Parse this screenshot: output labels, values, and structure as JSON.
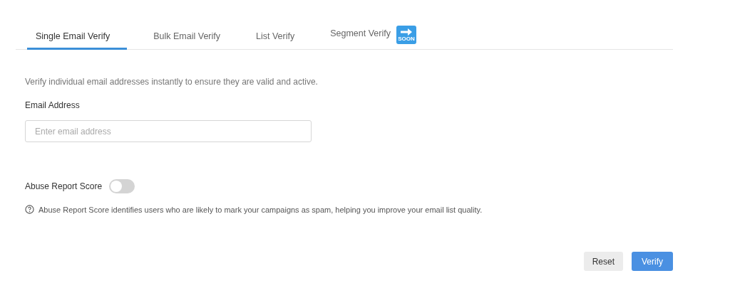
{
  "tabs": [
    {
      "label": "Single Email Verify",
      "selected": true
    },
    {
      "label": "Bulk Email Verify",
      "selected": false
    },
    {
      "label": "List Verify",
      "selected": false
    },
    {
      "label": "Segment Verify",
      "selected": false,
      "badge": "SOON"
    }
  ],
  "description": "Verify individual email addresses instantly to ensure they are valid and active.",
  "email_field": {
    "label": "Email Address",
    "placeholder": "Enter email address"
  },
  "abuse_toggle": {
    "label": "Abuse Report Score",
    "on": false
  },
  "help_text": "Abuse Report Score identifies users who are likely to mark your campaigns as spam, helping you improve your email list quality.",
  "buttons": [
    {
      "label": "Reset",
      "kind": "secondary"
    },
    {
      "label": "Verify",
      "kind": "primary"
    }
  ]
}
